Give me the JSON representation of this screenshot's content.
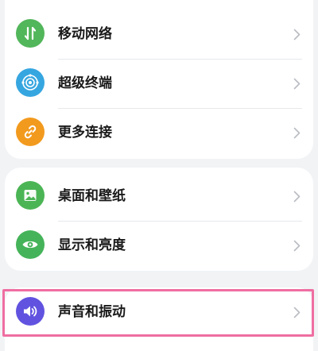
{
  "settings": {
    "items": [
      {
        "label": "移动网络",
        "icon": "mobile-network-icon",
        "color": "#52b65a"
      },
      {
        "label": "超级终端",
        "icon": "super-device-icon",
        "color": "#36a6e0"
      },
      {
        "label": "更多连接",
        "icon": "link-icon",
        "color": "#f29a1e"
      },
      {
        "label": "桌面和壁纸",
        "icon": "wallpaper-icon",
        "color": "#4bb555"
      },
      {
        "label": "显示和亮度",
        "icon": "eye-icon",
        "color": "#45b35a"
      },
      {
        "label": "声音和振动",
        "icon": "sound-icon",
        "color": "#6153e0"
      }
    ]
  },
  "colors": {
    "highlight": "#ef6ea1",
    "chevron": "#b9bcc2"
  }
}
